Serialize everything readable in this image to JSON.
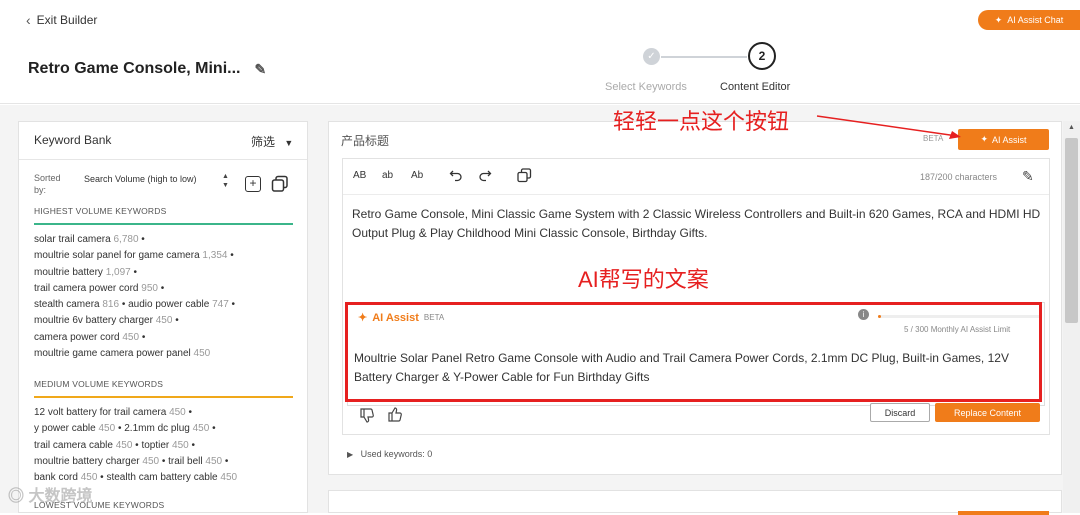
{
  "header": {
    "exit_label": "Exit Builder",
    "product_title": "Retro Game Console, Mini...",
    "chat_button": "AI Assist Chat",
    "steps": [
      {
        "number": "",
        "label": "Select Keywords"
      },
      {
        "number": "2",
        "label": "Content Editor"
      }
    ]
  },
  "keyword_bank": {
    "title": "Keyword Bank",
    "filter_label": "筛选",
    "sorted_by_label": "Sorted by:",
    "sorted_by_value": "Search Volume (high to low)",
    "sections": [
      {
        "heading": "HIGHEST VOLUME KEYWORDS",
        "color": "#3bb58a",
        "lines": [
          [
            {
              "kw": "solar trail camera",
              "vol": "6,780"
            }
          ],
          [
            {
              "kw": "moultrie solar panel for game camera",
              "vol": "1,354"
            }
          ],
          [
            {
              "kw": "moultrie battery",
              "vol": "1,097"
            }
          ],
          [
            {
              "kw": "trail camera power cord",
              "vol": "950"
            }
          ],
          [
            {
              "kw": "stealth camera",
              "vol": "816"
            },
            {
              "kw": "audio power cable",
              "vol": "747"
            }
          ],
          [
            {
              "kw": "moultrie 6v battery charger",
              "vol": "450"
            }
          ],
          [
            {
              "kw": "camera power cord",
              "vol": "450"
            }
          ],
          [
            {
              "kw": "moultrie game camera power panel",
              "vol": "450"
            }
          ]
        ]
      },
      {
        "heading": "MEDIUM VOLUME KEYWORDS",
        "color": "#f0a81a",
        "lines": [
          [
            {
              "kw": "12 volt battery for trail camera",
              "vol": "450"
            }
          ],
          [
            {
              "kw": "y power cable",
              "vol": "450"
            },
            {
              "kw": "2.1mm dc plug",
              "vol": "450"
            }
          ],
          [
            {
              "kw": "trail camera cable",
              "vol": "450"
            },
            {
              "kw": "toptier",
              "vol": "450"
            }
          ],
          [
            {
              "kw": "moultrie battery charger",
              "vol": "450"
            },
            {
              "kw": "trail bell",
              "vol": "450"
            }
          ],
          [
            {
              "kw": "bank cord",
              "vol": "450"
            },
            {
              "kw": "stealth cam battery cable",
              "vol": "450"
            }
          ]
        ]
      },
      {
        "heading": "LOWEST VOLUME KEYWORDS",
        "color": "#999999",
        "lines": []
      }
    ]
  },
  "editor": {
    "field_label": "产品标题",
    "beta_label": "BETA",
    "ai_assist_button": "AI Assist",
    "toolbar": {
      "upper": "AB",
      "lower": "ab",
      "title": "Ab"
    },
    "char_count": "187/200 characters",
    "title_text": "Retro Game Console, Mini Classic Game System with 2 Classic Wireless Controllers and Built-in 620 Games, RCA and HDMI HD Output Plug & Play Childhood Mini Classic Console, Birthday Gifts.",
    "ai_box": {
      "title": "AI Assist",
      "beta": "BETA",
      "limit_text": "5 / 300 Monthly AI Assist Limit",
      "limit_fraction": 0.0167,
      "suggestion": "Moultrie Solar Panel Retro Game Console with Audio and Trail Camera Power Cords, 2.1mm DC Plug, Built-in Games, 12V Battery Charger & Y-Power Cable for Fun Birthday Gifts",
      "discard": "Discard",
      "replace": "Replace Content"
    },
    "used_keywords": "Used keywords: 0"
  },
  "annotations": {
    "click_hint": "轻轻一点这个按钮",
    "ai_written": "AI帮写的文案"
  },
  "watermark": "大数跨境",
  "colors": {
    "accent": "#f07c1a",
    "annotation": "#e62020"
  }
}
